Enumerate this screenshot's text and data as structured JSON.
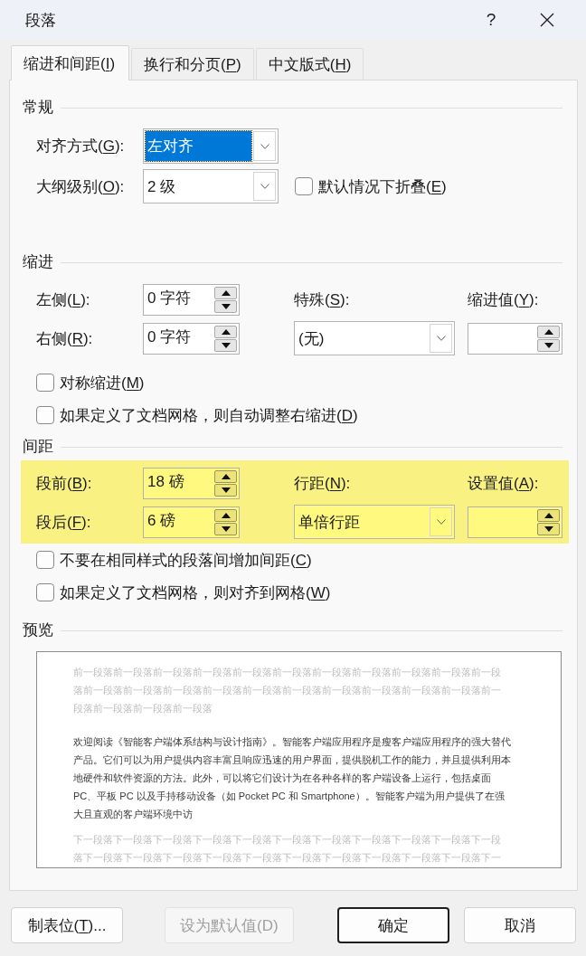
{
  "window": {
    "title": "段落",
    "help": "?"
  },
  "tabs": [
    {
      "label": {
        "pre": "缩进和间距(",
        "key": "I",
        "post": ")"
      },
      "selected": true
    },
    {
      "label": {
        "pre": "换行和分页(",
        "key": "P",
        "post": ")"
      },
      "selected": false
    },
    {
      "label": {
        "pre": "中文版式(",
        "key": "H",
        "post": ")"
      },
      "selected": false
    }
  ],
  "general": {
    "heading": "常规",
    "alignment": {
      "label": {
        "pre": "对齐方式(",
        "key": "G",
        "post": "):"
      },
      "value": "左对齐",
      "focused": true
    },
    "outline_level": {
      "label": {
        "pre": "大纲级别(",
        "key": "O",
        "post": "):"
      },
      "value": "2 级",
      "focused": false
    },
    "collapsed_by_default": {
      "label": {
        "pre": "默认情况下折叠(",
        "key": "E",
        "post": ")"
      },
      "checked": false
    }
  },
  "indentation": {
    "heading": "缩进",
    "left": {
      "label": {
        "pre": "左侧(",
        "key": "L",
        "post": "):"
      },
      "value": "0 字符"
    },
    "right": {
      "label": {
        "pre": "右侧(",
        "key": "R",
        "post": "):"
      },
      "value": "0 字符"
    },
    "special": {
      "label": {
        "pre": "特殊(",
        "key": "S",
        "post": "):"
      },
      "value": "(无)"
    },
    "by": {
      "label": {
        "pre": "缩进值(",
        "key": "Y",
        "post": "):"
      }
    },
    "options": [
      {
        "label": {
          "pre": "对称缩进(",
          "key": "M",
          "post": ")"
        },
        "checked": false
      },
      {
        "label": {
          "pre": "如果定义了文档网格，则自动调整右缩进(",
          "key": "D",
          "post": ")"
        },
        "checked": false
      }
    ]
  },
  "spacing": {
    "heading": "间距",
    "highlighted": true,
    "before": {
      "label": {
        "pre": "段前(",
        "key": "B",
        "post": "):"
      },
      "value": "18 磅"
    },
    "after": {
      "label": {
        "pre": "段后(",
        "key": "F",
        "post": "):"
      },
      "value": "6 磅"
    },
    "line_spacing": {
      "label": {
        "pre": "行距(",
        "key": "N",
        "post": "):"
      },
      "value": "单倍行距"
    },
    "at": {
      "label": {
        "pre": "设置值(",
        "key": "A",
        "post": "):"
      }
    },
    "options": [
      {
        "label": {
          "pre": "不要在相同样式的段落间增加间距(",
          "key": "C",
          "post": ")"
        },
        "checked": false
      },
      {
        "label": {
          "pre": "如果定义了文档网格，则对齐到网格(",
          "key": "W",
          "post": ")"
        },
        "checked": false
      }
    ]
  },
  "preview": {
    "heading": "预览",
    "previous_paragraph": "前一段落前一段落前一段落前一段落前一段落前一段落前一段落前一段落前一段落前一段落前一段落前一段落前一段落前一段落前一段落前一段落前一段落前一段落前一段落前一段落前一段落前一段落前一段落前一段落前一段落",
    "sample_paragraph": "欢迎阅读《智能客户端体系结构与设计指南》。智能客户端应用程序是瘦客户端应用程序的强大替代产品。它们可以为用户提供内容丰富且响应迅速的用户界面，提供脱机工作的能力，并且提供利用本地硬件和软件资源的方法。此外，可以将它们设计为在各种各样的客户端设备上运行，包括桌面 PC、平板 PC 以及手持移动设备（如 Pocket PC 和 Smartphone）。智能客户端为用户提供了在强大且直观的客户端环境中访",
    "next_paragraph": "下一段落下一段落下一段落下一段落下一段落下一段落下一段落下一段落下一段落下一段落下一段落下一段落下一段落下一段落下一段落下一段落下一段落下一段落下一段落下一段落下一段落下一"
  },
  "buttons": [
    {
      "label": {
        "pre": "制表位(",
        "key": "T",
        "post": ")..."
      },
      "disabled": false,
      "default": false
    },
    {
      "label": "设为默认值(D)",
      "disabled": true,
      "default": false
    },
    {
      "label": "确定",
      "disabled": false,
      "default": true
    },
    {
      "label": "取消",
      "disabled": false,
      "default": false
    }
  ]
}
